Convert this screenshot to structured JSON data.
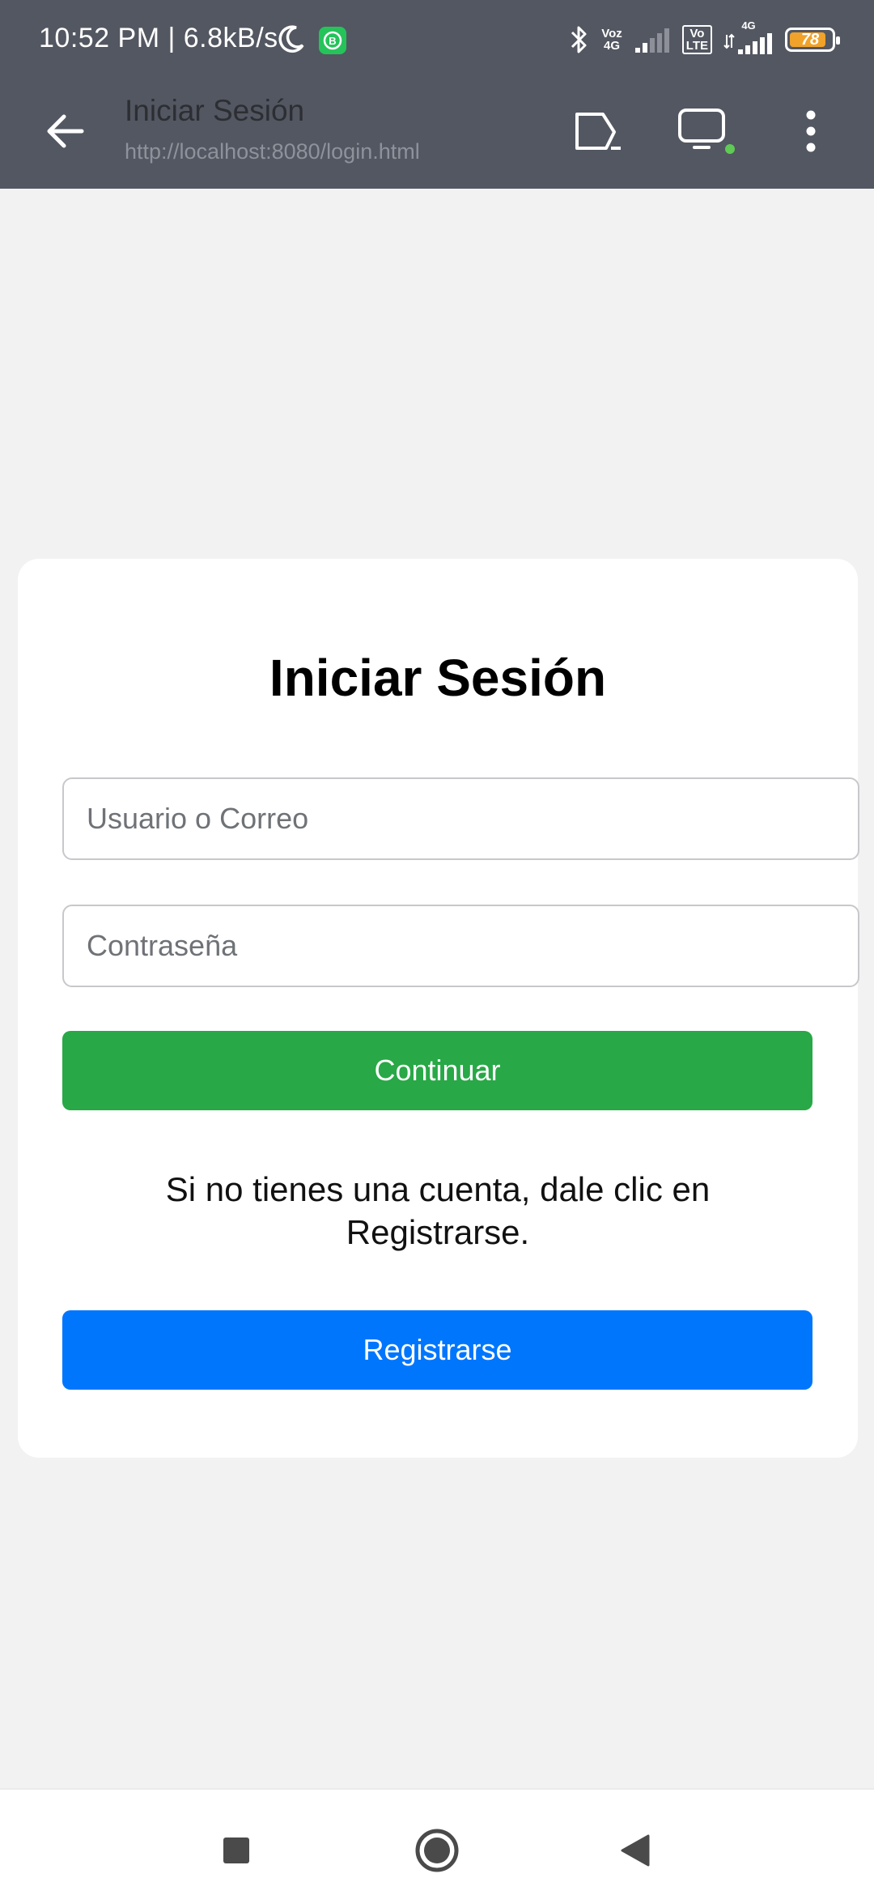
{
  "status_bar": {
    "time": "10:52 PM | 6.8kB/s",
    "network_label_1_top": "Voz",
    "network_label_1_bottom": "4G",
    "network_label_2_top": "Vo",
    "network_label_2_bottom": "LTE",
    "network_label_3": "4G",
    "battery_level": "78"
  },
  "app_bar": {
    "title": "Iniciar Sesión",
    "url": "http://localhost:8080/login.html"
  },
  "login": {
    "title": "Iniciar Sesión",
    "username_placeholder": "Usuario o Correo",
    "password_placeholder": "Contraseña",
    "continue_label": "Continuar",
    "info_text": "Si no tienes una cuenta, dale clic en Registrarse.",
    "register_label": "Registrarse"
  },
  "colors": {
    "topbar": "#535761",
    "continue_button": "#28a846",
    "register_button": "#0076fd",
    "background": "#f2f2f3"
  },
  "icons": {
    "back": "back-arrow-icon",
    "cast": "cast-icon",
    "device": "monitor-icon",
    "menu": "more-vert-icon",
    "nav_recent": "square-icon",
    "nav_home": "circle-icon",
    "nav_back": "triangle-back-icon"
  }
}
